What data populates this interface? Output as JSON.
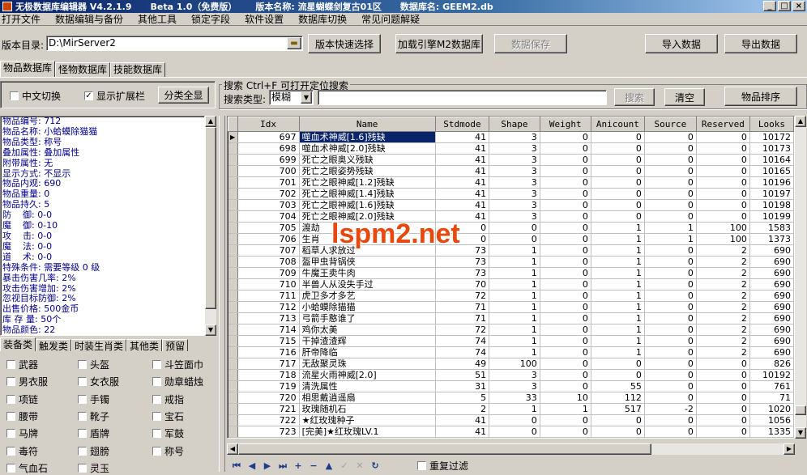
{
  "title": {
    "app": "无极数据库编辑器",
    "version": "V4.2.1.9",
    "beta": "Beta 1.0（免费版）",
    "version_name_label": "版本名称:",
    "version_name": "流星蝴蝶剑复古01区",
    "db_name_label": "数据库名:",
    "db_name": "GEEM2.db"
  },
  "menu": [
    "打开文件",
    "数据编辑与备份",
    "其他工具",
    "锁定字段",
    "软件设置",
    "数据库切换",
    "常见问题解疑"
  ],
  "toolbar": {
    "dir_label": "版本目录:",
    "dir_value": "D:\\MirServer2",
    "quick_select": "版本快速选择",
    "load_m2": "加载引擎M2数据库",
    "save_data": "数据保存",
    "import_data": "导入数据",
    "export_data": "导出数据"
  },
  "main_tabs": [
    "物品数据库",
    "怪物数据库",
    "技能数据库"
  ],
  "options": {
    "cn_switch": "中文切换",
    "show_ext": "显示扩展栏",
    "show_ext_checked": true,
    "cn_switch_checked": false,
    "classify_all": "分类全显"
  },
  "search": {
    "title": "搜索  Ctrl+F 可打开定位搜索",
    "type_label": "搜索类型:",
    "type_value": "模糊",
    "query": "",
    "search_btn": "搜索",
    "clear_btn": "清空",
    "sort_btn": "物品排序"
  },
  "info_lines": [
    "物品编号: 712",
    "物品名称: 小蛤蟆除猫猫",
    "物品类型: 称号",
    "叠加属性: 叠加属性",
    "附带属性: 无",
    "显示方式: 不显示",
    "物品内观: 690",
    "物品重量: 0",
    "物品持久: 5",
    "防    御: 0-0",
    "魔    御: 0-10",
    "攻    击: 0-0",
    "魔    法: 0-0",
    "道    术: 0-0",
    "特殊条件: 需要等级 0 级",
    "暴击伤害几率: 2%",
    "攻击伤害增加: 2%",
    "忽视目标防御: 2%",
    "出售价格: 500金币",
    "库 存 量: 50个",
    "物品颜色: 22"
  ],
  "cat_tabs": [
    "装备类",
    "触发类",
    "时装生肖类",
    "其他类",
    "预留"
  ],
  "equip_items": [
    "武器",
    "头盔",
    "斗笠面巾",
    "男衣服",
    "女衣服",
    "勋章蜡烛",
    "项链",
    "手镯",
    "戒指",
    "腰带",
    "靴子",
    "宝石",
    "马牌",
    "盾牌",
    "军鼓",
    "毒符",
    "翅膀",
    "称号",
    "气血石",
    "灵玉"
  ],
  "grid": {
    "columns": [
      "Idx",
      "Name",
      "Stdmode",
      "Shape",
      "Weight",
      "Anicount",
      "Source",
      "Reserved",
      "Looks"
    ],
    "selected_index": 0,
    "rows": [
      [
        "697",
        "噬血术神威[1.6]残缺",
        "41",
        "3",
        "0",
        "0",
        "0",
        "0",
        "10172"
      ],
      [
        "698",
        "噬血术神威[2.0]残缺",
        "41",
        "3",
        "0",
        "0",
        "0",
        "0",
        "10173"
      ],
      [
        "699",
        "死亡之眼奥义残缺",
        "41",
        "3",
        "0",
        "0",
        "0",
        "0",
        "10164"
      ],
      [
        "700",
        "死亡之眼姿势残缺",
        "41",
        "3",
        "0",
        "0",
        "0",
        "0",
        "10165"
      ],
      [
        "701",
        "死亡之眼神威[1.2]残缺",
        "41",
        "3",
        "0",
        "0",
        "0",
        "0",
        "10196"
      ],
      [
        "702",
        "死亡之眼神威[1.4]残缺",
        "41",
        "3",
        "0",
        "0",
        "0",
        "0",
        "10197"
      ],
      [
        "703",
        "死亡之眼神威[1.6]残缺",
        "41",
        "3",
        "0",
        "0",
        "0",
        "0",
        "10198"
      ],
      [
        "704",
        "死亡之眼神威[2.0]残缺",
        "41",
        "3",
        "0",
        "0",
        "0",
        "0",
        "10199"
      ],
      [
        "705",
        "渡劫",
        "0",
        "0",
        "0",
        "1",
        "1",
        "100",
        "1583"
      ],
      [
        "706",
        "生肖",
        "0",
        "0",
        "0",
        "1",
        "1",
        "100",
        "1373"
      ],
      [
        "707",
        "稻草人求放过",
        "73",
        "1",
        "0",
        "1",
        "0",
        "2",
        "690"
      ],
      [
        "708",
        "盔甲虫背锅侠",
        "73",
        "1",
        "0",
        "1",
        "0",
        "2",
        "690"
      ],
      [
        "709",
        "牛魔王卖牛肉",
        "73",
        "1",
        "0",
        "1",
        "0",
        "2",
        "690"
      ],
      [
        "710",
        "半兽人从没失手过",
        "70",
        "1",
        "0",
        "1",
        "0",
        "2",
        "690"
      ],
      [
        "711",
        "虎卫多才多艺",
        "72",
        "1",
        "0",
        "1",
        "0",
        "2",
        "690"
      ],
      [
        "712",
        "小蛤蟆除猫猫",
        "71",
        "1",
        "0",
        "1",
        "0",
        "2",
        "690"
      ],
      [
        "713",
        "弓箭手憨谁了",
        "71",
        "1",
        "0",
        "1",
        "0",
        "2",
        "690"
      ],
      [
        "714",
        "鸡你太美",
        "72",
        "1",
        "0",
        "1",
        "0",
        "2",
        "690"
      ],
      [
        "715",
        "干掉渣渣辉",
        "74",
        "1",
        "0",
        "1",
        "0",
        "2",
        "690"
      ],
      [
        "716",
        "肝帝降临",
        "74",
        "1",
        "0",
        "1",
        "0",
        "2",
        "690"
      ],
      [
        "717",
        "无敌聚灵珠",
        "49",
        "100",
        "0",
        "0",
        "0",
        "0",
        "826"
      ],
      [
        "718",
        "流星火雨神威[2.0]",
        "51",
        "3",
        "0",
        "0",
        "0",
        "0",
        "10192"
      ],
      [
        "719",
        "清洗属性",
        "31",
        "3",
        "0",
        "55",
        "0",
        "0",
        "761"
      ],
      [
        "720",
        "相思戴逍遥扇",
        "5",
        "33",
        "10",
        "112",
        "0",
        "0",
        "71"
      ],
      [
        "721",
        "玫瑰随机石",
        "2",
        "1",
        "1",
        "517",
        "-2",
        "0",
        "1020"
      ],
      [
        "722",
        "★红玫瑰种子",
        "41",
        "0",
        "0",
        "0",
        "0",
        "0",
        "1056"
      ],
      [
        "723",
        "[完美]★红玫瑰LV.1",
        "41",
        "0",
        "0",
        "0",
        "0",
        "0",
        "1335"
      ]
    ]
  },
  "repeat_filter": "重复过滤",
  "watermark": "lspm2.net",
  "colors": {
    "titlebar": "#0a246a",
    "info_text": "#00008b",
    "selection": "#0a246a",
    "watermark": "#e8470e"
  }
}
